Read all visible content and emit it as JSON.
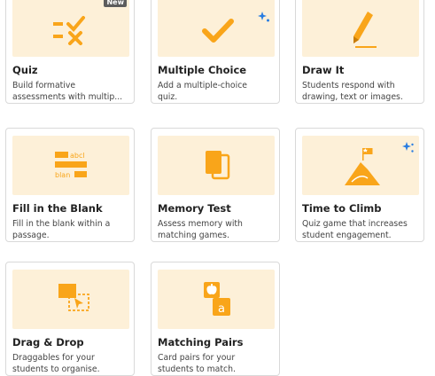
{
  "colors": {
    "accent": "#f9a51a",
    "thumb_bg": "#fdf0d8",
    "sparkle": "#2a7de1"
  },
  "cards": [
    {
      "title": "Quiz",
      "desc_lines": [
        "Build formative",
        "assessments with multip..."
      ],
      "icon": "quiz-icon",
      "badge": "New"
    },
    {
      "title": "Multiple Choice",
      "desc_lines": [
        "Add a multiple-choice",
        "quiz."
      ],
      "icon": "checkmark-icon"
    },
    {
      "title": "Draw It",
      "desc_lines": [
        "Students respond with",
        "drawing, text or images."
      ],
      "icon": "pencil-icon"
    },
    {
      "title": "Fill in the Blank",
      "desc_lines": [
        "Fill in the blank within a",
        "passage."
      ],
      "icon": "fill-blank-icon",
      "icon_text": [
        "abcl",
        "blan"
      ]
    },
    {
      "title": "Memory Test",
      "desc_lines": [
        "Assess memory with",
        "matching games."
      ],
      "icon": "cards-icon"
    },
    {
      "title": "Time to Climb",
      "desc_lines": [
        "Quiz game that increases",
        "student engagement."
      ],
      "icon": "mountain-flag-icon"
    },
    {
      "title": "Drag & Drop",
      "desc_lines": [
        "Draggables for your",
        "students to organise."
      ],
      "icon": "drag-drop-icon"
    },
    {
      "title": "Matching Pairs",
      "desc_lines": [
        "Card pairs for your",
        "students to match."
      ],
      "icon": "matching-pairs-icon",
      "icon_text": [
        "a"
      ]
    }
  ]
}
